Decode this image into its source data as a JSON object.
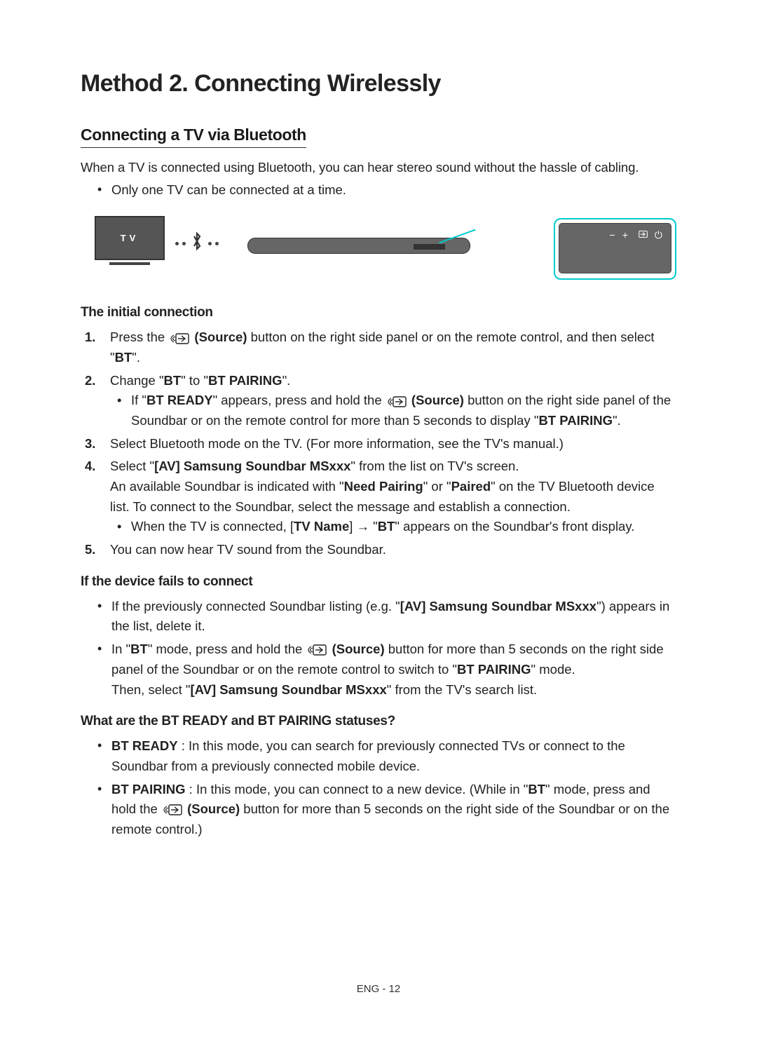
{
  "title": "Method 2. Connecting Wirelessly",
  "section1": {
    "heading": "Connecting a TV via Bluetooth",
    "intro": "When a TV is connected using Bluetooth, you can hear stereo sound without the hassle of cabling.",
    "bullet1": "Only one TV can be connected at a time."
  },
  "diagram": {
    "tv_label": "TV"
  },
  "initial": {
    "heading": "The initial connection",
    "step1_a": "Press the ",
    "source_label": " (Source)",
    "step1_b": " button on the right side panel or on the remote control, and then select \"",
    "bt": "BT",
    "step1_c": "\".",
    "step2_a": "Change \"",
    "step2_b": "\" to \"",
    "btpairing": "BT PAIRING",
    "step2_c": "\".",
    "step2_sub_a": "If \"",
    "btready": "BT READY",
    "step2_sub_b": "\" appears, press and hold the ",
    "step2_sub_c": " button on the right side panel of the Soundbar or on the remote control for more than 5 seconds to display \"",
    "step2_sub_d": "\".",
    "step3": "Select Bluetooth mode on the TV. (For more information, see the TV's manual.)",
    "step4_a": "Select \"",
    "device": "[AV] Samsung Soundbar MSxxx",
    "step4_b": "\" from the list on TV's screen.",
    "step4_c": "An available Soundbar is indicated with \"",
    "needpairing": "Need Pairing",
    "step4_d": "\" or \"",
    "paired": "Paired",
    "step4_e": "\" on the TV Bluetooth device list. To connect to the Soundbar, select the message and establish a connection.",
    "step4_sub_a": "When the TV is connected, [",
    "tvname": "TV Name",
    "step4_sub_b": "] → \"",
    "step4_sub_c": "\" appears on the Soundbar's front display.",
    "step5": "You can now hear TV sound from the Soundbar."
  },
  "fails": {
    "heading": "If the device fails to connect",
    "b1_a": "If the previously connected Soundbar listing (e.g. \"",
    "b1_b": "\") appears in the list, delete it.",
    "b2_a": "In \"",
    "b2_b": "\" mode, press and hold the ",
    "b2_c": " button for more than 5 seconds on the right side panel of the Soundbar or on the remote control to switch to \"",
    "b2_d": "\" mode.",
    "b2_e": "Then, select \"",
    "b2_f": "\" from the TV's search list."
  },
  "statuses": {
    "heading": "What are the BT READY and BT PAIRING statuses?",
    "b1_a": "BT READY",
    "b1_b": " : In this mode, you can search for previously connected TVs or connect to the Soundbar from a previously connected mobile device.",
    "b2_a": "BT PAIRING",
    "b2_b": " : In this mode, you can connect to a new device. (While in \"",
    "b2_c": "\" mode, press and hold the ",
    "b2_d": " button for more than 5 seconds on the right side of the Soundbar or on the remote control.)"
  },
  "footer": "ENG - 12"
}
